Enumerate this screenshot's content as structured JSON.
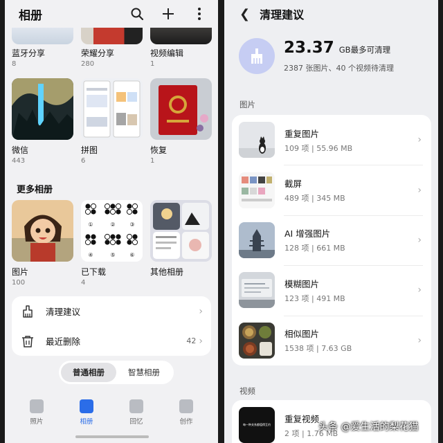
{
  "left": {
    "header": {
      "title": "相册"
    },
    "top_albums": [
      {
        "name": "蓝牙分享",
        "count": "8"
      },
      {
        "name": "荣耀分享",
        "count": "280"
      },
      {
        "name": "视频编辑",
        "count": "1"
      }
    ],
    "albums": [
      {
        "name": "微信",
        "count": "443"
      },
      {
        "name": "拼图",
        "count": "6"
      },
      {
        "name": "恢复",
        "count": "1"
      }
    ],
    "more_title": "更多相册",
    "more_albums": [
      {
        "name": "图片",
        "count": "100"
      },
      {
        "name": "已下载",
        "count": "4"
      },
      {
        "name": "其他相册",
        "count": ""
      }
    ],
    "grid_numbers": [
      "①",
      "②",
      "③",
      "④",
      "⑤",
      "⑥"
    ],
    "tools": [
      {
        "label": "清理建议",
        "value": ""
      },
      {
        "label": "最近删除",
        "value": "42"
      }
    ],
    "toggle": {
      "left": "普通相册",
      "right": "智慧相册"
    },
    "tabs": [
      {
        "label": "照片",
        "icon": "photo-icon"
      },
      {
        "label": "相册",
        "icon": "album-icon"
      },
      {
        "label": "回忆",
        "icon": "memory-icon"
      },
      {
        "label": "创作",
        "icon": "create-icon"
      }
    ],
    "active_tab_color": "#2b6de8"
  },
  "right": {
    "header": {
      "title": "清理建议"
    },
    "summary": {
      "value": "23.37",
      "unit": "GB最多可清理",
      "detail": "2387 张图片、40 个视频待清理"
    },
    "section_images": "图片",
    "items": [
      {
        "name": "重复图片",
        "meta": "109 项 | 55.96 MB"
      },
      {
        "name": "截屏",
        "meta": "489 项 | 345 MB"
      },
      {
        "name": "AI 增强图片",
        "meta": "128 项 | 661 MB"
      },
      {
        "name": "模糊图片",
        "meta": "123 项 | 491 MB"
      },
      {
        "name": "相似图片",
        "meta": "1538 项 | 7.63 GB"
      }
    ],
    "section_videos": "视频",
    "video_items": [
      {
        "name": "重复视频",
        "meta": "2 项 | 1.76 MB",
        "thumb_text": "每一种关系都值得互约"
      }
    ]
  },
  "watermark": "头条 @爱生活的梨花猫"
}
